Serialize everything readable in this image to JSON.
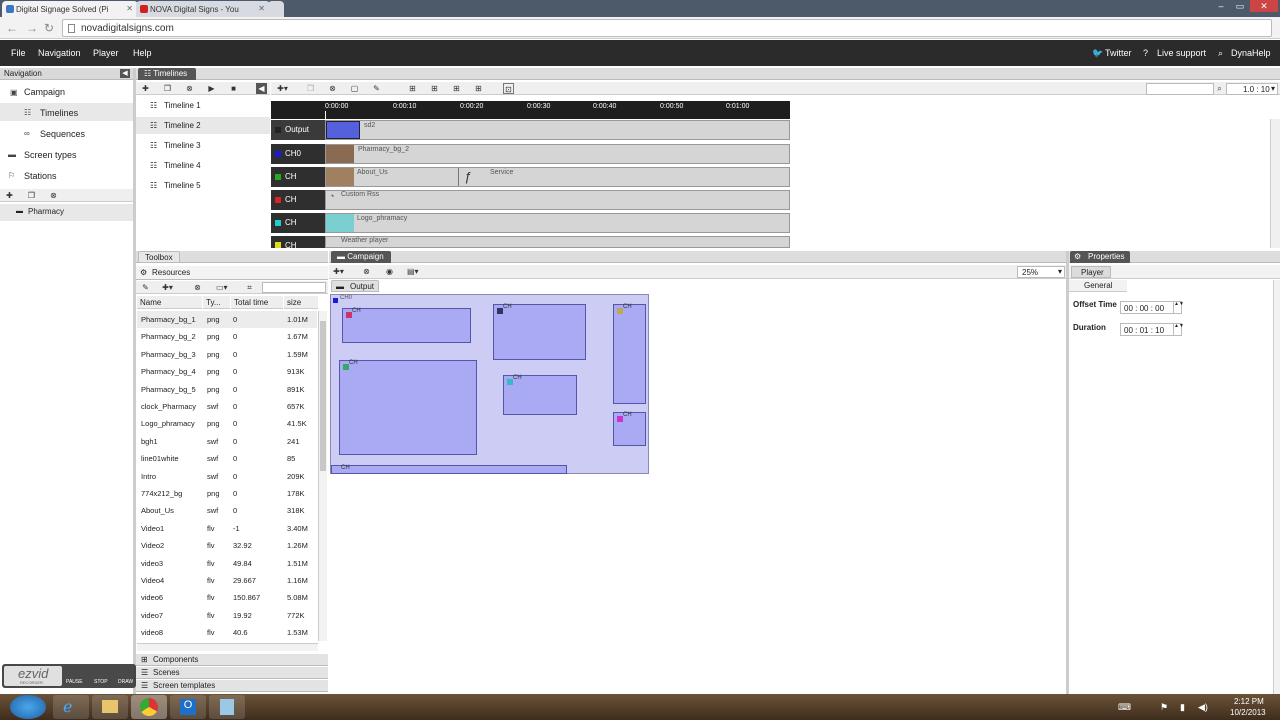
{
  "browser": {
    "tabs": [
      {
        "title": "Digital Signage Solved (Pi",
        "active": true,
        "fav_color": "#3b78c4"
      },
      {
        "title": "NOVA Digital Signs - You",
        "active": false,
        "fav_color": "#d21f1f"
      }
    ],
    "url": "novadigitalsigns.com",
    "window_buttons": [
      "–",
      "▭",
      "✕"
    ]
  },
  "menubar": {
    "items": [
      "File",
      "Navigation",
      "Player",
      "Help"
    ],
    "right_items": [
      "Twitter",
      "Live support",
      "DynaHelp"
    ]
  },
  "navigation": {
    "title": "Navigation",
    "items": [
      {
        "label": "Campaign",
        "icon": "campaign-icon"
      },
      {
        "label": "Timelines",
        "icon": "timelines-icon"
      },
      {
        "label": "Sequences",
        "icon": "sequences-icon"
      },
      {
        "label": "Screen types",
        "icon": "screen-icon"
      },
      {
        "label": "Stations",
        "icon": "station-icon"
      }
    ],
    "station_item": "Pharmacy"
  },
  "timelines_panel": {
    "tab": "Timelines",
    "items": [
      "Timeline 1",
      "Timeline 2",
      "Timeline 3",
      "Timeline 4",
      "Timeline 5"
    ],
    "selected": 1,
    "zoom": "1.0 : 10",
    "ruler_ticks": [
      "0:00:00",
      "0:00:10",
      "0:00:20",
      "0:00:30",
      "0:00:40",
      "0:00:50",
      "0:01:00"
    ],
    "channels": [
      {
        "label": "Output",
        "color": "#222222",
        "clips": [
          {
            "name": "sd2",
            "start": 0,
            "end": 0.065
          }
        ]
      },
      {
        "label": "CH0",
        "color": "#1a1ad9",
        "clips": [
          {
            "name": "Pharmacy_bg_2",
            "start": 0,
            "end": 1
          }
        ]
      },
      {
        "label": "CH",
        "color": "#22aa22",
        "clips": [
          {
            "name": "About_Us",
            "start": 0,
            "end": 0.285
          },
          {
            "name": "Service",
            "start": 0.285,
            "end": 1
          }
        ]
      },
      {
        "label": "CH",
        "color": "#dd2222",
        "clips": [
          {
            "name": "Custom Rss",
            "start": 0,
            "end": 1
          }
        ]
      },
      {
        "label": "CH",
        "color": "#22cccc",
        "clips": [
          {
            "name": "Logo_phramacy",
            "start": 0,
            "end": 1
          }
        ]
      },
      {
        "label": "CH",
        "color": "#dddd22",
        "clips": [
          {
            "name": "Weather player",
            "start": 0,
            "end": 1
          }
        ]
      }
    ]
  },
  "toolbox": {
    "tab": "Toolbox",
    "resources_title": "Resources",
    "columns": [
      "Name",
      "Ty...",
      "Total time",
      "size"
    ],
    "rows": [
      [
        "Pharmacy_bg_1",
        "png",
        "0",
        "1.01M"
      ],
      [
        "Pharmacy_bg_2",
        "png",
        "0",
        "1.67M"
      ],
      [
        "Pharmacy_bg_3",
        "png",
        "0",
        "1.59M"
      ],
      [
        "Pharmacy_bg_4",
        "png",
        "0",
        "913K"
      ],
      [
        "Pharmacy_bg_5",
        "png",
        "0",
        "891K"
      ],
      [
        "clock_Pharmacy",
        "swf",
        "0",
        "657K"
      ],
      [
        "Logo_phramacy",
        "png",
        "0",
        "41.5K"
      ],
      [
        "bgh1",
        "swf",
        "0",
        "241"
      ],
      [
        "line01white",
        "swf",
        "0",
        "85"
      ],
      [
        "Intro",
        "swf",
        "0",
        "209K"
      ],
      [
        "774x212_bg",
        "png",
        "0",
        "178K"
      ],
      [
        "About_Us",
        "swf",
        "0",
        "318K"
      ],
      [
        "Video1",
        "flv",
        "-1",
        "3.40M"
      ],
      [
        "Video2",
        "flv",
        "32.92",
        "1.26M"
      ],
      [
        "video3",
        "flv",
        "49.84",
        "1.51M"
      ],
      [
        "Video4",
        "flv",
        "29.667",
        "1.16M"
      ],
      [
        "video6",
        "flv",
        "150.867",
        "5.08M"
      ],
      [
        "video7",
        "flv",
        "19.92",
        "772K"
      ],
      [
        "video8",
        "flv",
        "40.6",
        "1.53M"
      ]
    ],
    "sections": [
      "Components",
      "Scenes",
      "Screen templates"
    ]
  },
  "campaign": {
    "tab": "Campaign",
    "zoom": "25%",
    "output_tab": "Output",
    "canvas_label": "CH0",
    "screens": [
      {
        "label": "CH",
        "color": "#cc3366"
      },
      {
        "label": "CH",
        "color": "#333366"
      },
      {
        "label": "CH",
        "color": "#bbaa55"
      },
      {
        "label": "CH",
        "color": "#33aa66"
      },
      {
        "label": "CH",
        "color": "#33bbcc"
      },
      {
        "label": "CH",
        "color": "#cc33cc"
      },
      {
        "label": "CH",
        "color": "#aaaaf4"
      }
    ]
  },
  "properties": {
    "tab": "Properties",
    "subtab": "Player",
    "section": "General",
    "offset_label": "Offset Time",
    "offset_value": "00 : 00 : 00",
    "duration_label": "Duration",
    "duration_value": "00 : 01 : 10"
  },
  "recorder": {
    "brand": "ezvid",
    "sub": "RECORDER",
    "buttons": [
      "PAUSE",
      "STOP",
      "DRAW"
    ]
  },
  "taskbar": {
    "time": "2:12 PM",
    "date": "10/2/2013"
  }
}
